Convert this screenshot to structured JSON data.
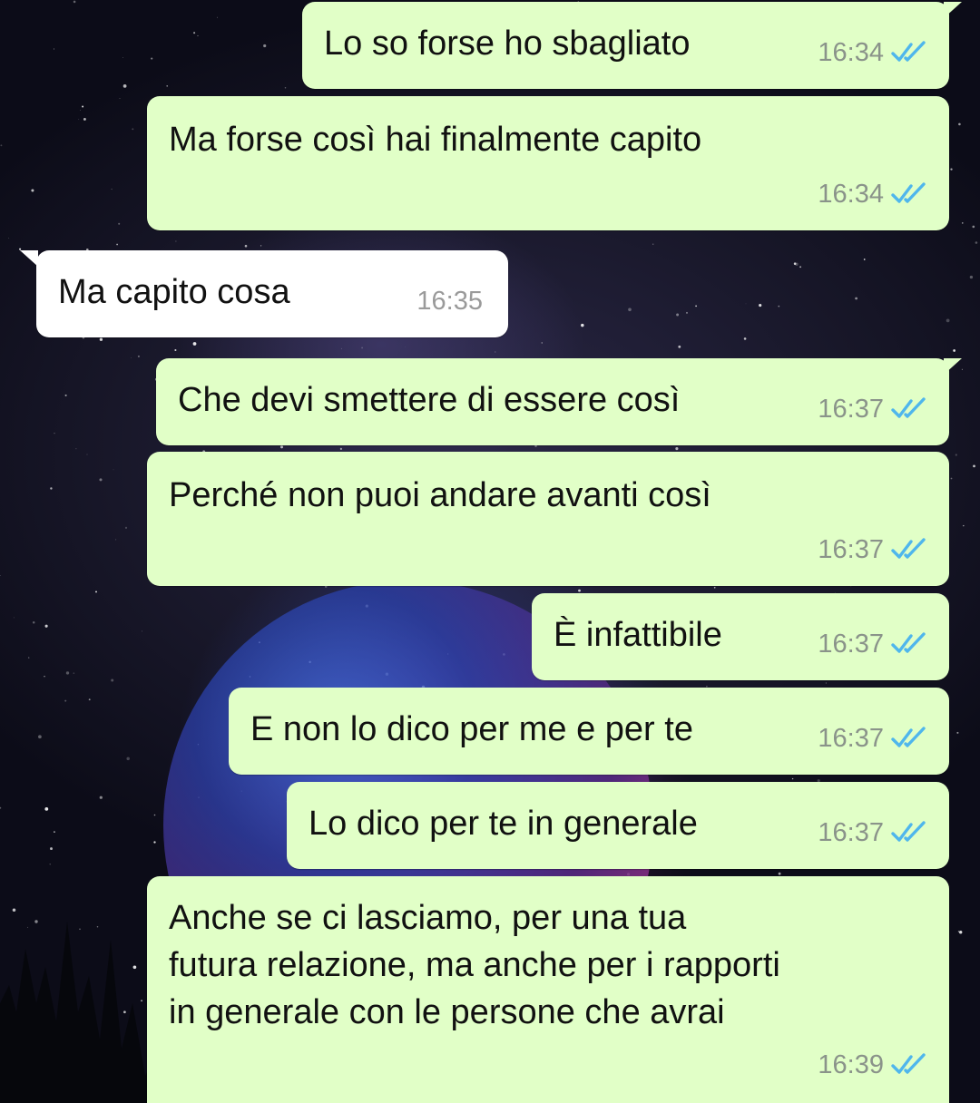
{
  "messages": [
    {
      "text": "Lo so forse ho sbagliato",
      "time": "16:34",
      "direction": "outgoing",
      "status": "read"
    },
    {
      "text": "Ma forse così hai finalmente capito",
      "time": "16:34",
      "direction": "outgoing",
      "status": "read"
    },
    {
      "text": "Ma capito cosa",
      "time": "16:35",
      "direction": "incoming"
    },
    {
      "text": "Che devi smettere di essere così",
      "time": "16:37",
      "direction": "outgoing",
      "status": "read"
    },
    {
      "text": "Perché non puoi andare avanti così",
      "time": "16:37",
      "direction": "outgoing",
      "status": "read"
    },
    {
      "text": "È infattibile",
      "time": "16:37",
      "direction": "outgoing",
      "status": "read"
    },
    {
      "text": "E non lo dico per me e per te",
      "time": "16:37",
      "direction": "outgoing",
      "status": "read"
    },
    {
      "text": "Lo dico per te in generale",
      "time": "16:37",
      "direction": "outgoing",
      "status": "read"
    },
    {
      "text": "Anche se ci lasciamo, per una tua\nfutura relazione, ma anche per i rapporti\nin generale con le persone che avrai",
      "time": "16:39",
      "direction": "outgoing",
      "status": "read"
    }
  ],
  "colors": {
    "outgoing_bubble": "#e1ffc7",
    "incoming_bubble": "#ffffff",
    "read_tick": "#4fb6ec",
    "timestamp": "#8a938a"
  },
  "icons": {
    "read_receipt": "double-check-icon"
  }
}
